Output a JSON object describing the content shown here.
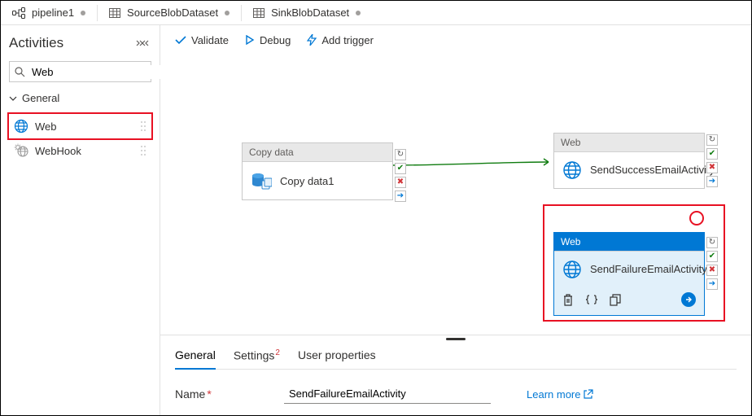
{
  "tabs": [
    {
      "label": "pipeline1",
      "kind": "pipeline",
      "dirty": true,
      "active": true
    },
    {
      "label": "SourceBlobDataset",
      "kind": "dataset",
      "dirty": true,
      "active": false
    },
    {
      "label": "SinkBlobDataset",
      "kind": "dataset",
      "dirty": true,
      "active": false
    }
  ],
  "panel": {
    "title": "Activities",
    "search_value": "Web",
    "group": "General",
    "items": [
      {
        "label": "Web",
        "icon": "globe"
      },
      {
        "label": "WebHook",
        "icon": "gear-globe"
      }
    ]
  },
  "toolbar": {
    "validate": "Validate",
    "debug": "Debug",
    "add_trigger": "Add trigger"
  },
  "canvas": {
    "nodes": {
      "copy": {
        "header": "Copy data",
        "title": "Copy data1"
      },
      "success": {
        "header": "Web",
        "title": "SendSuccessEmailActivity"
      },
      "failure": {
        "header": "Web",
        "title": "SendFailureEmailActivity"
      }
    }
  },
  "props": {
    "tabs": {
      "general": "General",
      "settings": "Settings",
      "user_properties": "User properties"
    },
    "settings_badge": "2",
    "name_label": "Name",
    "name_value": "SendFailureEmailActivity",
    "learn_more": "Learn more"
  }
}
